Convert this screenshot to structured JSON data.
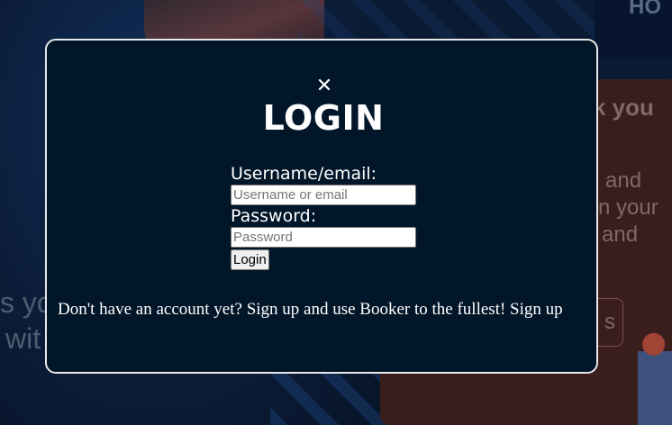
{
  "background": {
    "header_partial": "HO",
    "card_partial_title": "k you",
    "card_partial_line1": "and",
    "card_partial_line2": "n your",
    "card_partial_line3": "and",
    "card_button_partial": "s",
    "left_partial_line1": "s yo",
    "left_partial_line2": "wit"
  },
  "modal": {
    "close_symbol": "✕",
    "title": "LOGIN",
    "username_label": "Username/email:",
    "username_placeholder": "Username or email",
    "username_value": "",
    "password_label": "Password:",
    "password_placeholder": "Password",
    "password_value": "",
    "login_button_label": "Login",
    "signup_text": "Don't have an account yet? Sign up and use Booker to the fullest!",
    "signup_link": "Sign up"
  },
  "colors": {
    "modal_background": "#021629",
    "modal_border": "#e8e8e8",
    "text": "#ffffff"
  }
}
